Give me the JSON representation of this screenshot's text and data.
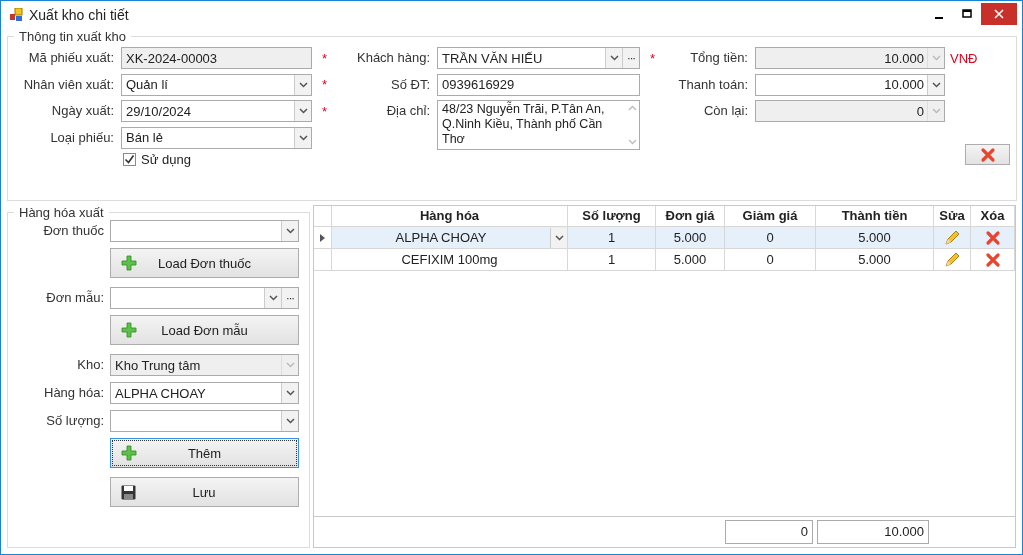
{
  "window": {
    "title": "Xuất kho chi tiết"
  },
  "info_group": {
    "title": "Thông tin xuất kho",
    "columns": [
      [
        {
          "kind": "text",
          "label": "Mã phiếu xuất:",
          "value": "XK-2024-00003",
          "disabled": true,
          "required_mark": "*"
        },
        {
          "kind": "combo",
          "label": "Nhân viên xuất:",
          "value": "Quản lí",
          "disabled": false,
          "required_mark": "*"
        },
        {
          "kind": "combo",
          "label": "Ngày xuất:",
          "value": "29/10/2024",
          "disabled": false,
          "required_mark": "*"
        },
        {
          "kind": "combo",
          "label": "Loại phiếu:",
          "value": "Bán lẻ",
          "disabled": false
        },
        {
          "kind": "checkbox",
          "label": "Sử dụng",
          "checked": true
        }
      ],
      [
        {
          "kind": "combo_more",
          "label": "Khách hàng:",
          "value": "TRẦN VĂN HIẾU",
          "more": "···",
          "disabled": false,
          "required_mark": "*"
        },
        {
          "kind": "text",
          "label": "Số ĐT:",
          "value": "0939616929",
          "disabled": false
        },
        {
          "kind": "textarea",
          "label": "Địa chỉ:",
          "value": "48/23 Nguyễn Trãi, P.Tân An, Q.Ninh Kiều, Thành phố Cần Thơ",
          "disabled": false
        }
      ],
      [
        {
          "kind": "number",
          "label": "Tổng tiền:",
          "value": "10.000",
          "disabled": true,
          "unit": "VNĐ"
        },
        {
          "kind": "number",
          "label": "Thanh toán:",
          "value": "10.000",
          "disabled": false
        },
        {
          "kind": "number",
          "label": "Còn lại:",
          "value": "0",
          "disabled": true
        }
      ]
    ]
  },
  "goods_group": {
    "title": "Hàng hóa xuất",
    "items": [
      {
        "kind": "combo",
        "label": "Đơn thuốc",
        "value": "",
        "disabled": false
      },
      {
        "kind": "add_button",
        "label": "Load Đơn thuốc",
        "focused": false
      },
      {
        "kind": "combo_more",
        "label": "Đơn mẫu:",
        "value": "",
        "more": "···",
        "disabled": false
      },
      {
        "kind": "add_button",
        "label": "Load Đơn mẫu",
        "focused": false
      },
      {
        "kind": "combo",
        "label": "Kho:",
        "value": "Kho Trung tâm",
        "disabled": true
      },
      {
        "kind": "combo",
        "label": "Hàng hóa:",
        "value": "ALPHA CHOAY",
        "disabled": false
      },
      {
        "kind": "combo",
        "label": "Số lượng:",
        "value": "",
        "disabled": false
      },
      {
        "kind": "add_button",
        "label": "Thêm",
        "focused": true
      },
      {
        "kind": "save_button",
        "label": "Lưu",
        "focused": false
      }
    ]
  },
  "table": {
    "columns": [
      "Hàng hóa",
      "Số lượng",
      "Đơn giá",
      "Giảm giá",
      "Thành tiền",
      "Sửa",
      "Xóa"
    ],
    "rows": [
      {
        "selected": true,
        "cells": [
          "ALPHA CHOAY",
          "1",
          "5.000",
          "0",
          "5.000"
        ]
      },
      {
        "selected": false,
        "cells": [
          "CEFIXIM 100mg",
          "1",
          "5.000",
          "0",
          "5.000"
        ]
      }
    ],
    "footer": [
      "0",
      "10.000"
    ]
  }
}
